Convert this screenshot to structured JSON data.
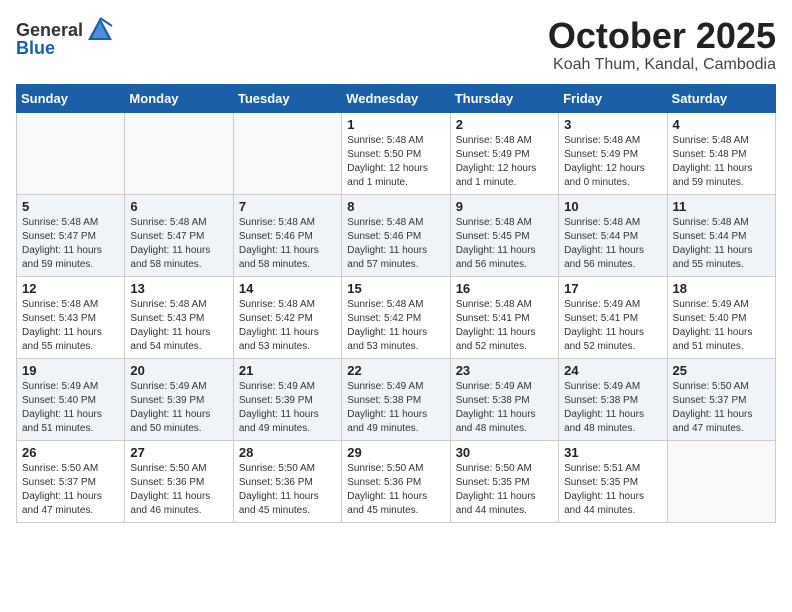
{
  "header": {
    "logo_general": "General",
    "logo_blue": "Blue",
    "month": "October 2025",
    "location": "Koah Thum, Kandal, Cambodia"
  },
  "weekdays": [
    "Sunday",
    "Monday",
    "Tuesday",
    "Wednesday",
    "Thursday",
    "Friday",
    "Saturday"
  ],
  "weeks": [
    [
      {
        "day": "",
        "info": ""
      },
      {
        "day": "",
        "info": ""
      },
      {
        "day": "",
        "info": ""
      },
      {
        "day": "1",
        "info": "Sunrise: 5:48 AM\nSunset: 5:50 PM\nDaylight: 12 hours\nand 1 minute."
      },
      {
        "day": "2",
        "info": "Sunrise: 5:48 AM\nSunset: 5:49 PM\nDaylight: 12 hours\nand 1 minute."
      },
      {
        "day": "3",
        "info": "Sunrise: 5:48 AM\nSunset: 5:49 PM\nDaylight: 12 hours\nand 0 minutes."
      },
      {
        "day": "4",
        "info": "Sunrise: 5:48 AM\nSunset: 5:48 PM\nDaylight: 11 hours\nand 59 minutes."
      }
    ],
    [
      {
        "day": "5",
        "info": "Sunrise: 5:48 AM\nSunset: 5:47 PM\nDaylight: 11 hours\nand 59 minutes."
      },
      {
        "day": "6",
        "info": "Sunrise: 5:48 AM\nSunset: 5:47 PM\nDaylight: 11 hours\nand 58 minutes."
      },
      {
        "day": "7",
        "info": "Sunrise: 5:48 AM\nSunset: 5:46 PM\nDaylight: 11 hours\nand 58 minutes."
      },
      {
        "day": "8",
        "info": "Sunrise: 5:48 AM\nSunset: 5:46 PM\nDaylight: 11 hours\nand 57 minutes."
      },
      {
        "day": "9",
        "info": "Sunrise: 5:48 AM\nSunset: 5:45 PM\nDaylight: 11 hours\nand 56 minutes."
      },
      {
        "day": "10",
        "info": "Sunrise: 5:48 AM\nSunset: 5:44 PM\nDaylight: 11 hours\nand 56 minutes."
      },
      {
        "day": "11",
        "info": "Sunrise: 5:48 AM\nSunset: 5:44 PM\nDaylight: 11 hours\nand 55 minutes."
      }
    ],
    [
      {
        "day": "12",
        "info": "Sunrise: 5:48 AM\nSunset: 5:43 PM\nDaylight: 11 hours\nand 55 minutes."
      },
      {
        "day": "13",
        "info": "Sunrise: 5:48 AM\nSunset: 5:43 PM\nDaylight: 11 hours\nand 54 minutes."
      },
      {
        "day": "14",
        "info": "Sunrise: 5:48 AM\nSunset: 5:42 PM\nDaylight: 11 hours\nand 53 minutes."
      },
      {
        "day": "15",
        "info": "Sunrise: 5:48 AM\nSunset: 5:42 PM\nDaylight: 11 hours\nand 53 minutes."
      },
      {
        "day": "16",
        "info": "Sunrise: 5:48 AM\nSunset: 5:41 PM\nDaylight: 11 hours\nand 52 minutes."
      },
      {
        "day": "17",
        "info": "Sunrise: 5:49 AM\nSunset: 5:41 PM\nDaylight: 11 hours\nand 52 minutes."
      },
      {
        "day": "18",
        "info": "Sunrise: 5:49 AM\nSunset: 5:40 PM\nDaylight: 11 hours\nand 51 minutes."
      }
    ],
    [
      {
        "day": "19",
        "info": "Sunrise: 5:49 AM\nSunset: 5:40 PM\nDaylight: 11 hours\nand 51 minutes."
      },
      {
        "day": "20",
        "info": "Sunrise: 5:49 AM\nSunset: 5:39 PM\nDaylight: 11 hours\nand 50 minutes."
      },
      {
        "day": "21",
        "info": "Sunrise: 5:49 AM\nSunset: 5:39 PM\nDaylight: 11 hours\nand 49 minutes."
      },
      {
        "day": "22",
        "info": "Sunrise: 5:49 AM\nSunset: 5:38 PM\nDaylight: 11 hours\nand 49 minutes."
      },
      {
        "day": "23",
        "info": "Sunrise: 5:49 AM\nSunset: 5:38 PM\nDaylight: 11 hours\nand 48 minutes."
      },
      {
        "day": "24",
        "info": "Sunrise: 5:49 AM\nSunset: 5:38 PM\nDaylight: 11 hours\nand 48 minutes."
      },
      {
        "day": "25",
        "info": "Sunrise: 5:50 AM\nSunset: 5:37 PM\nDaylight: 11 hours\nand 47 minutes."
      }
    ],
    [
      {
        "day": "26",
        "info": "Sunrise: 5:50 AM\nSunset: 5:37 PM\nDaylight: 11 hours\nand 47 minutes."
      },
      {
        "day": "27",
        "info": "Sunrise: 5:50 AM\nSunset: 5:36 PM\nDaylight: 11 hours\nand 46 minutes."
      },
      {
        "day": "28",
        "info": "Sunrise: 5:50 AM\nSunset: 5:36 PM\nDaylight: 11 hours\nand 45 minutes."
      },
      {
        "day": "29",
        "info": "Sunrise: 5:50 AM\nSunset: 5:36 PM\nDaylight: 11 hours\nand 45 minutes."
      },
      {
        "day": "30",
        "info": "Sunrise: 5:50 AM\nSunset: 5:35 PM\nDaylight: 11 hours\nand 44 minutes."
      },
      {
        "day": "31",
        "info": "Sunrise: 5:51 AM\nSunset: 5:35 PM\nDaylight: 11 hours\nand 44 minutes."
      },
      {
        "day": "",
        "info": ""
      }
    ]
  ]
}
